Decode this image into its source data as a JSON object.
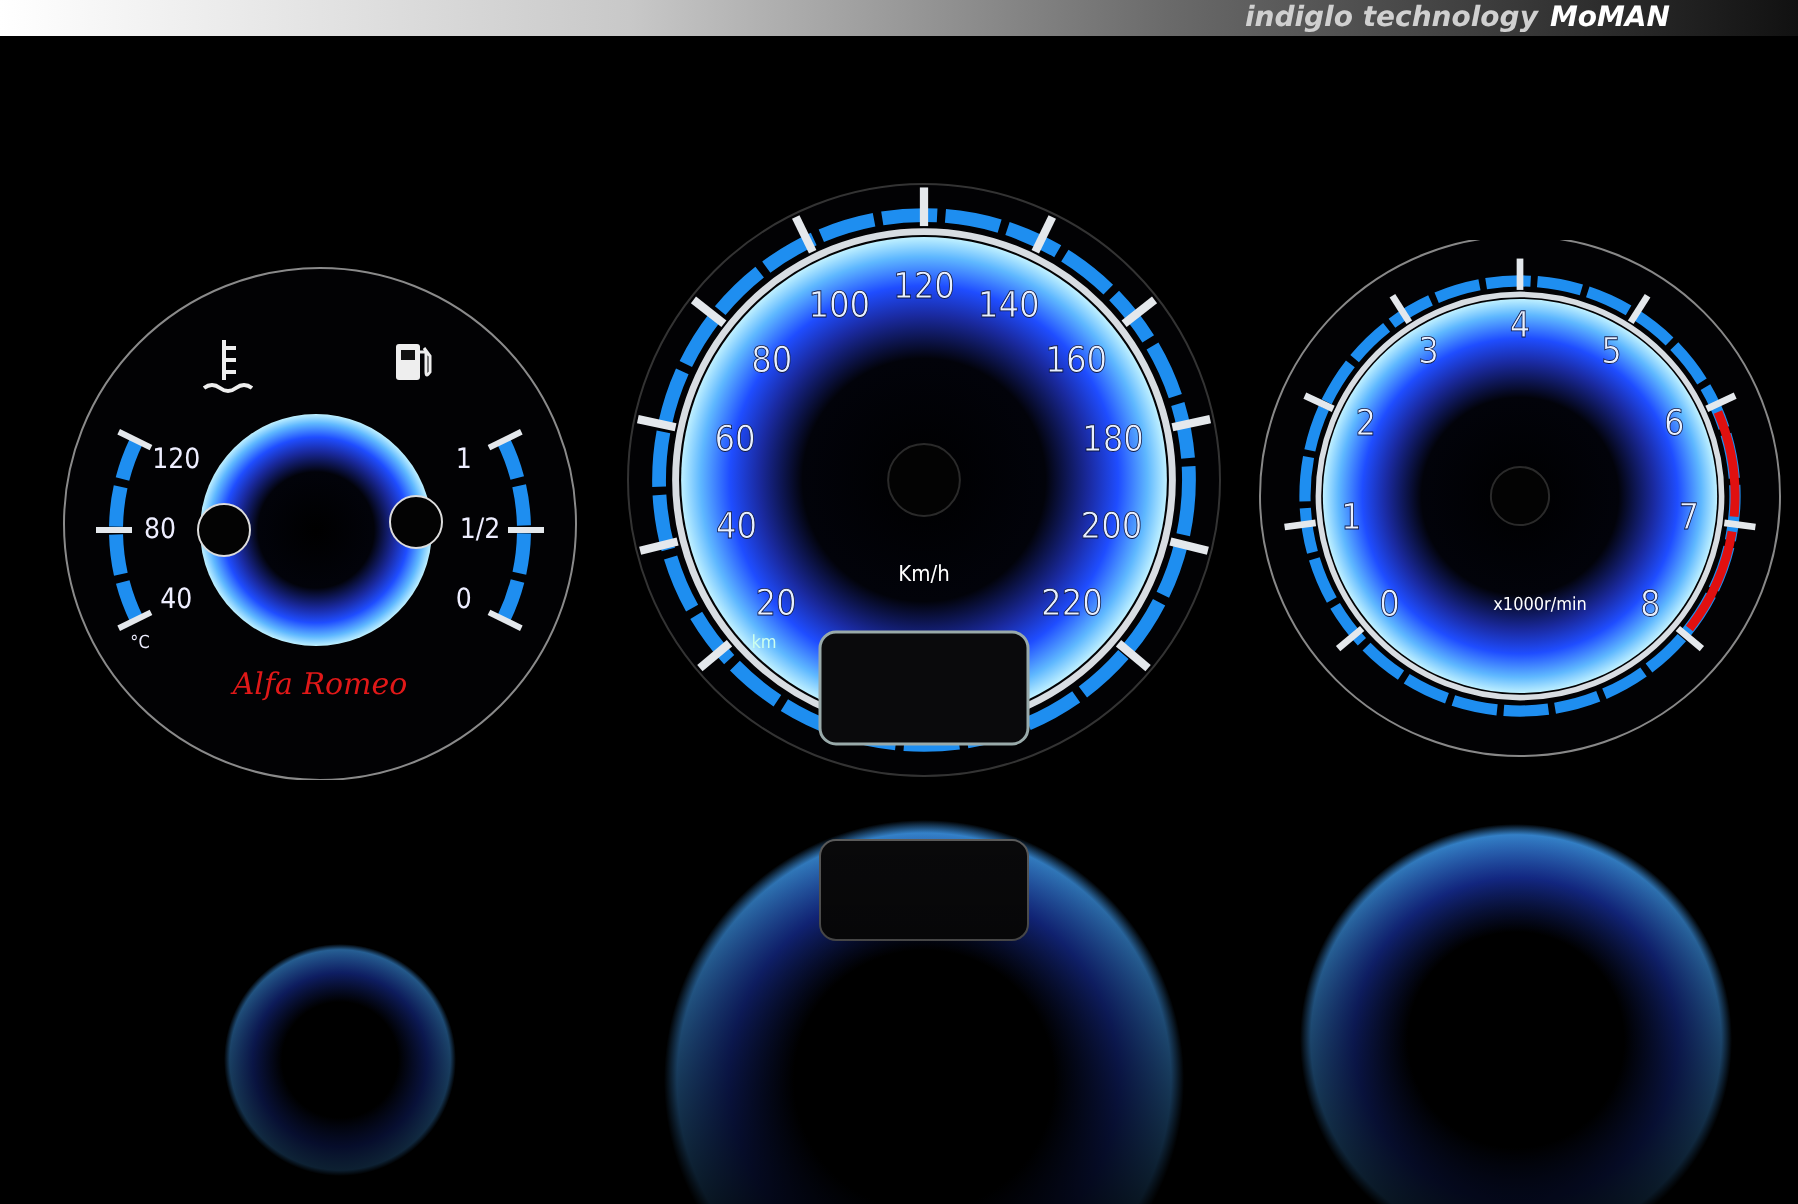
{
  "banner": {
    "text": "indiglo technology",
    "brand": "MoMAN"
  },
  "gauges": [
    {
      "kind": "combo",
      "left_scale": [
        "120",
        "80",
        "40"
      ],
      "left_unit": "°C",
      "right_scale": [
        "1",
        "1/2",
        "0"
      ],
      "logo": "Alfa Romeo"
    },
    {
      "kind": "speedometer",
      "scale": [
        {
          "text": "20",
          "red": false
        },
        {
          "text": "40",
          "red": false
        },
        {
          "text": "60",
          "red": false
        },
        {
          "text": "80",
          "red": false
        },
        {
          "text": "100",
          "red": false
        },
        {
          "text": "120",
          "red": false
        },
        {
          "text": "140",
          "red": false
        },
        {
          "text": "160",
          "red": false
        },
        {
          "text": "180",
          "red": false
        },
        {
          "text": "200",
          "red": false
        },
        {
          "text": "220",
          "red": false
        }
      ],
      "unit": "Km/h",
      "odometer_label": "km"
    },
    {
      "kind": "tachometer",
      "scale": [
        {
          "text": "0",
          "red": false
        },
        {
          "text": "1",
          "red": false
        },
        {
          "text": "2",
          "red": false
        },
        {
          "text": "3",
          "red": false
        },
        {
          "text": "4",
          "red": false
        },
        {
          "text": "5",
          "red": false
        },
        {
          "text": "6",
          "red": true
        },
        {
          "text": "7",
          "red": true
        },
        {
          "text": "8",
          "red": false
        }
      ],
      "unit": "x1000r/min"
    }
  ]
}
